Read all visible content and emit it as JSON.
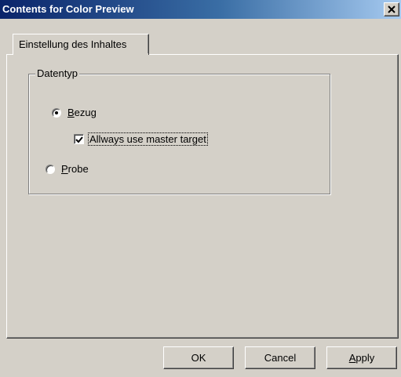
{
  "window": {
    "title": "Contents for Color Preview",
    "close_glyph": "✕"
  },
  "tabs": [
    {
      "label": "Einstellung des Inhaltes",
      "active": true
    }
  ],
  "group": {
    "legend": "Datentyp",
    "options": [
      {
        "label_first": "B",
        "label_rest": "ezug",
        "selected": true
      },
      {
        "label_first": "P",
        "label_rest": "robe",
        "selected": false
      }
    ],
    "checkbox": {
      "label": "Allways use master target",
      "checked": true
    }
  },
  "buttons": {
    "ok": "OK",
    "cancel": "Cancel",
    "apply_first": "A",
    "apply_rest": "pply"
  }
}
